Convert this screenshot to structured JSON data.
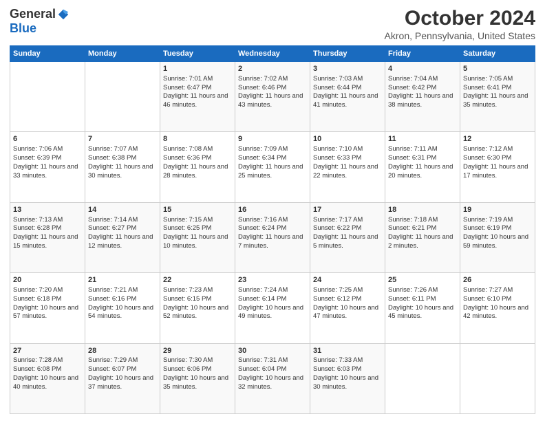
{
  "logo": {
    "general": "General",
    "blue": "Blue"
  },
  "title": "October 2024",
  "subtitle": "Akron, Pennsylvania, United States",
  "days_of_week": [
    "Sunday",
    "Monday",
    "Tuesday",
    "Wednesday",
    "Thursday",
    "Friday",
    "Saturday"
  ],
  "weeks": [
    [
      {
        "day": "",
        "sunrise": "",
        "sunset": "",
        "daylight": ""
      },
      {
        "day": "",
        "sunrise": "",
        "sunset": "",
        "daylight": ""
      },
      {
        "day": "1",
        "sunrise": "Sunrise: 7:01 AM",
        "sunset": "Sunset: 6:47 PM",
        "daylight": "Daylight: 11 hours and 46 minutes."
      },
      {
        "day": "2",
        "sunrise": "Sunrise: 7:02 AM",
        "sunset": "Sunset: 6:46 PM",
        "daylight": "Daylight: 11 hours and 43 minutes."
      },
      {
        "day": "3",
        "sunrise": "Sunrise: 7:03 AM",
        "sunset": "Sunset: 6:44 PM",
        "daylight": "Daylight: 11 hours and 41 minutes."
      },
      {
        "day": "4",
        "sunrise": "Sunrise: 7:04 AM",
        "sunset": "Sunset: 6:42 PM",
        "daylight": "Daylight: 11 hours and 38 minutes."
      },
      {
        "day": "5",
        "sunrise": "Sunrise: 7:05 AM",
        "sunset": "Sunset: 6:41 PM",
        "daylight": "Daylight: 11 hours and 35 minutes."
      }
    ],
    [
      {
        "day": "6",
        "sunrise": "Sunrise: 7:06 AM",
        "sunset": "Sunset: 6:39 PM",
        "daylight": "Daylight: 11 hours and 33 minutes."
      },
      {
        "day": "7",
        "sunrise": "Sunrise: 7:07 AM",
        "sunset": "Sunset: 6:38 PM",
        "daylight": "Daylight: 11 hours and 30 minutes."
      },
      {
        "day": "8",
        "sunrise": "Sunrise: 7:08 AM",
        "sunset": "Sunset: 6:36 PM",
        "daylight": "Daylight: 11 hours and 28 minutes."
      },
      {
        "day": "9",
        "sunrise": "Sunrise: 7:09 AM",
        "sunset": "Sunset: 6:34 PM",
        "daylight": "Daylight: 11 hours and 25 minutes."
      },
      {
        "day": "10",
        "sunrise": "Sunrise: 7:10 AM",
        "sunset": "Sunset: 6:33 PM",
        "daylight": "Daylight: 11 hours and 22 minutes."
      },
      {
        "day": "11",
        "sunrise": "Sunrise: 7:11 AM",
        "sunset": "Sunset: 6:31 PM",
        "daylight": "Daylight: 11 hours and 20 minutes."
      },
      {
        "day": "12",
        "sunrise": "Sunrise: 7:12 AM",
        "sunset": "Sunset: 6:30 PM",
        "daylight": "Daylight: 11 hours and 17 minutes."
      }
    ],
    [
      {
        "day": "13",
        "sunrise": "Sunrise: 7:13 AM",
        "sunset": "Sunset: 6:28 PM",
        "daylight": "Daylight: 11 hours and 15 minutes."
      },
      {
        "day": "14",
        "sunrise": "Sunrise: 7:14 AM",
        "sunset": "Sunset: 6:27 PM",
        "daylight": "Daylight: 11 hours and 12 minutes."
      },
      {
        "day": "15",
        "sunrise": "Sunrise: 7:15 AM",
        "sunset": "Sunset: 6:25 PM",
        "daylight": "Daylight: 11 hours and 10 minutes."
      },
      {
        "day": "16",
        "sunrise": "Sunrise: 7:16 AM",
        "sunset": "Sunset: 6:24 PM",
        "daylight": "Daylight: 11 hours and 7 minutes."
      },
      {
        "day": "17",
        "sunrise": "Sunrise: 7:17 AM",
        "sunset": "Sunset: 6:22 PM",
        "daylight": "Daylight: 11 hours and 5 minutes."
      },
      {
        "day": "18",
        "sunrise": "Sunrise: 7:18 AM",
        "sunset": "Sunset: 6:21 PM",
        "daylight": "Daylight: 11 hours and 2 minutes."
      },
      {
        "day": "19",
        "sunrise": "Sunrise: 7:19 AM",
        "sunset": "Sunset: 6:19 PM",
        "daylight": "Daylight: 10 hours and 59 minutes."
      }
    ],
    [
      {
        "day": "20",
        "sunrise": "Sunrise: 7:20 AM",
        "sunset": "Sunset: 6:18 PM",
        "daylight": "Daylight: 10 hours and 57 minutes."
      },
      {
        "day": "21",
        "sunrise": "Sunrise: 7:21 AM",
        "sunset": "Sunset: 6:16 PM",
        "daylight": "Daylight: 10 hours and 54 minutes."
      },
      {
        "day": "22",
        "sunrise": "Sunrise: 7:23 AM",
        "sunset": "Sunset: 6:15 PM",
        "daylight": "Daylight: 10 hours and 52 minutes."
      },
      {
        "day": "23",
        "sunrise": "Sunrise: 7:24 AM",
        "sunset": "Sunset: 6:14 PM",
        "daylight": "Daylight: 10 hours and 49 minutes."
      },
      {
        "day": "24",
        "sunrise": "Sunrise: 7:25 AM",
        "sunset": "Sunset: 6:12 PM",
        "daylight": "Daylight: 10 hours and 47 minutes."
      },
      {
        "day": "25",
        "sunrise": "Sunrise: 7:26 AM",
        "sunset": "Sunset: 6:11 PM",
        "daylight": "Daylight: 10 hours and 45 minutes."
      },
      {
        "day": "26",
        "sunrise": "Sunrise: 7:27 AM",
        "sunset": "Sunset: 6:10 PM",
        "daylight": "Daylight: 10 hours and 42 minutes."
      }
    ],
    [
      {
        "day": "27",
        "sunrise": "Sunrise: 7:28 AM",
        "sunset": "Sunset: 6:08 PM",
        "daylight": "Daylight: 10 hours and 40 minutes."
      },
      {
        "day": "28",
        "sunrise": "Sunrise: 7:29 AM",
        "sunset": "Sunset: 6:07 PM",
        "daylight": "Daylight: 10 hours and 37 minutes."
      },
      {
        "day": "29",
        "sunrise": "Sunrise: 7:30 AM",
        "sunset": "Sunset: 6:06 PM",
        "daylight": "Daylight: 10 hours and 35 minutes."
      },
      {
        "day": "30",
        "sunrise": "Sunrise: 7:31 AM",
        "sunset": "Sunset: 6:04 PM",
        "daylight": "Daylight: 10 hours and 32 minutes."
      },
      {
        "day": "31",
        "sunrise": "Sunrise: 7:33 AM",
        "sunset": "Sunset: 6:03 PM",
        "daylight": "Daylight: 10 hours and 30 minutes."
      },
      {
        "day": "",
        "sunrise": "",
        "sunset": "",
        "daylight": ""
      },
      {
        "day": "",
        "sunrise": "",
        "sunset": "",
        "daylight": ""
      }
    ]
  ]
}
